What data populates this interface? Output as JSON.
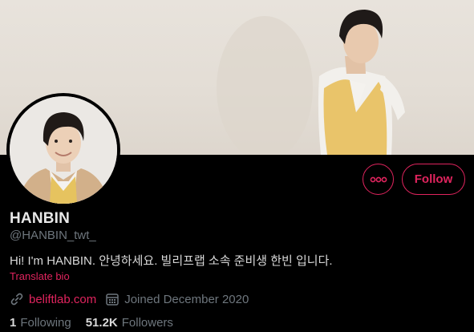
{
  "profile": {
    "name": "HANBIN",
    "handle": "@HANBIN_twt_",
    "bio": "Hi! I'm HANBIN. 안녕하세요. 빌리프랩 소속 준비생 한빈 입니다.",
    "translate_label": "Translate bio",
    "website": "beliftlab.com",
    "joined": "Joined December 2020",
    "following_count": "1",
    "following_label": "Following",
    "followers_count": "51.2K",
    "followers_label": "Followers"
  },
  "actions": {
    "follow_label": "Follow",
    "more_icon": "more-icon"
  },
  "icons": {
    "link": "link-icon",
    "calendar": "calendar-icon"
  },
  "colors": {
    "accent": "#e0245e",
    "background": "#000000",
    "secondary_text": "#6e767d"
  }
}
